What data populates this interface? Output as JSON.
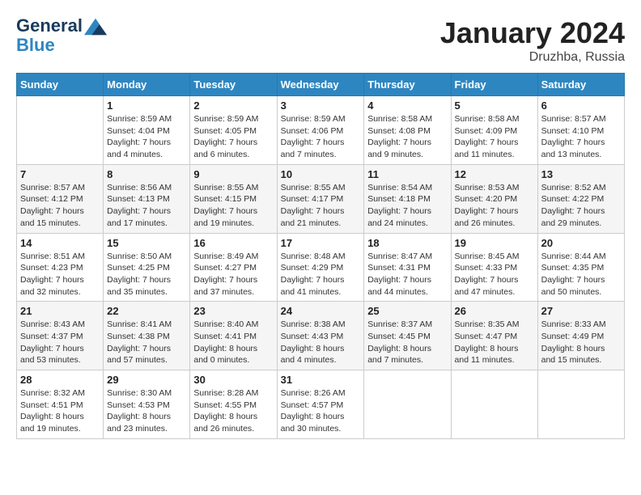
{
  "header": {
    "logo_line1": "General",
    "logo_line2": "Blue",
    "month": "January 2024",
    "location": "Druzhba, Russia"
  },
  "weekdays": [
    "Sunday",
    "Monday",
    "Tuesday",
    "Wednesday",
    "Thursday",
    "Friday",
    "Saturday"
  ],
  "weeks": [
    [
      {
        "day": "",
        "sunrise": "",
        "sunset": "",
        "daylight": ""
      },
      {
        "day": "1",
        "sunrise": "Sunrise: 8:59 AM",
        "sunset": "Sunset: 4:04 PM",
        "daylight": "Daylight: 7 hours and 4 minutes."
      },
      {
        "day": "2",
        "sunrise": "Sunrise: 8:59 AM",
        "sunset": "Sunset: 4:05 PM",
        "daylight": "Daylight: 7 hours and 6 minutes."
      },
      {
        "day": "3",
        "sunrise": "Sunrise: 8:59 AM",
        "sunset": "Sunset: 4:06 PM",
        "daylight": "Daylight: 7 hours and 7 minutes."
      },
      {
        "day": "4",
        "sunrise": "Sunrise: 8:58 AM",
        "sunset": "Sunset: 4:08 PM",
        "daylight": "Daylight: 7 hours and 9 minutes."
      },
      {
        "day": "5",
        "sunrise": "Sunrise: 8:58 AM",
        "sunset": "Sunset: 4:09 PM",
        "daylight": "Daylight: 7 hours and 11 minutes."
      },
      {
        "day": "6",
        "sunrise": "Sunrise: 8:57 AM",
        "sunset": "Sunset: 4:10 PM",
        "daylight": "Daylight: 7 hours and 13 minutes."
      }
    ],
    [
      {
        "day": "7",
        "sunrise": "Sunrise: 8:57 AM",
        "sunset": "Sunset: 4:12 PM",
        "daylight": "Daylight: 7 hours and 15 minutes."
      },
      {
        "day": "8",
        "sunrise": "Sunrise: 8:56 AM",
        "sunset": "Sunset: 4:13 PM",
        "daylight": "Daylight: 7 hours and 17 minutes."
      },
      {
        "day": "9",
        "sunrise": "Sunrise: 8:55 AM",
        "sunset": "Sunset: 4:15 PM",
        "daylight": "Daylight: 7 hours and 19 minutes."
      },
      {
        "day": "10",
        "sunrise": "Sunrise: 8:55 AM",
        "sunset": "Sunset: 4:17 PM",
        "daylight": "Daylight: 7 hours and 21 minutes."
      },
      {
        "day": "11",
        "sunrise": "Sunrise: 8:54 AM",
        "sunset": "Sunset: 4:18 PM",
        "daylight": "Daylight: 7 hours and 24 minutes."
      },
      {
        "day": "12",
        "sunrise": "Sunrise: 8:53 AM",
        "sunset": "Sunset: 4:20 PM",
        "daylight": "Daylight: 7 hours and 26 minutes."
      },
      {
        "day": "13",
        "sunrise": "Sunrise: 8:52 AM",
        "sunset": "Sunset: 4:22 PM",
        "daylight": "Daylight: 7 hours and 29 minutes."
      }
    ],
    [
      {
        "day": "14",
        "sunrise": "Sunrise: 8:51 AM",
        "sunset": "Sunset: 4:23 PM",
        "daylight": "Daylight: 7 hours and 32 minutes."
      },
      {
        "day": "15",
        "sunrise": "Sunrise: 8:50 AM",
        "sunset": "Sunset: 4:25 PM",
        "daylight": "Daylight: 7 hours and 35 minutes."
      },
      {
        "day": "16",
        "sunrise": "Sunrise: 8:49 AM",
        "sunset": "Sunset: 4:27 PM",
        "daylight": "Daylight: 7 hours and 37 minutes."
      },
      {
        "day": "17",
        "sunrise": "Sunrise: 8:48 AM",
        "sunset": "Sunset: 4:29 PM",
        "daylight": "Daylight: 7 hours and 41 minutes."
      },
      {
        "day": "18",
        "sunrise": "Sunrise: 8:47 AM",
        "sunset": "Sunset: 4:31 PM",
        "daylight": "Daylight: 7 hours and 44 minutes."
      },
      {
        "day": "19",
        "sunrise": "Sunrise: 8:45 AM",
        "sunset": "Sunset: 4:33 PM",
        "daylight": "Daylight: 7 hours and 47 minutes."
      },
      {
        "day": "20",
        "sunrise": "Sunrise: 8:44 AM",
        "sunset": "Sunset: 4:35 PM",
        "daylight": "Daylight: 7 hours and 50 minutes."
      }
    ],
    [
      {
        "day": "21",
        "sunrise": "Sunrise: 8:43 AM",
        "sunset": "Sunset: 4:37 PM",
        "daylight": "Daylight: 7 hours and 53 minutes."
      },
      {
        "day": "22",
        "sunrise": "Sunrise: 8:41 AM",
        "sunset": "Sunset: 4:38 PM",
        "daylight": "Daylight: 7 hours and 57 minutes."
      },
      {
        "day": "23",
        "sunrise": "Sunrise: 8:40 AM",
        "sunset": "Sunset: 4:41 PM",
        "daylight": "Daylight: 8 hours and 0 minutes."
      },
      {
        "day": "24",
        "sunrise": "Sunrise: 8:38 AM",
        "sunset": "Sunset: 4:43 PM",
        "daylight": "Daylight: 8 hours and 4 minutes."
      },
      {
        "day": "25",
        "sunrise": "Sunrise: 8:37 AM",
        "sunset": "Sunset: 4:45 PM",
        "daylight": "Daylight: 8 hours and 7 minutes."
      },
      {
        "day": "26",
        "sunrise": "Sunrise: 8:35 AM",
        "sunset": "Sunset: 4:47 PM",
        "daylight": "Daylight: 8 hours and 11 minutes."
      },
      {
        "day": "27",
        "sunrise": "Sunrise: 8:33 AM",
        "sunset": "Sunset: 4:49 PM",
        "daylight": "Daylight: 8 hours and 15 minutes."
      }
    ],
    [
      {
        "day": "28",
        "sunrise": "Sunrise: 8:32 AM",
        "sunset": "Sunset: 4:51 PM",
        "daylight": "Daylight: 8 hours and 19 minutes."
      },
      {
        "day": "29",
        "sunrise": "Sunrise: 8:30 AM",
        "sunset": "Sunset: 4:53 PM",
        "daylight": "Daylight: 8 hours and 23 minutes."
      },
      {
        "day": "30",
        "sunrise": "Sunrise: 8:28 AM",
        "sunset": "Sunset: 4:55 PM",
        "daylight": "Daylight: 8 hours and 26 minutes."
      },
      {
        "day": "31",
        "sunrise": "Sunrise: 8:26 AM",
        "sunset": "Sunset: 4:57 PM",
        "daylight": "Daylight: 8 hours and 30 minutes."
      },
      {
        "day": "",
        "sunrise": "",
        "sunset": "",
        "daylight": ""
      },
      {
        "day": "",
        "sunrise": "",
        "sunset": "",
        "daylight": ""
      },
      {
        "day": "",
        "sunrise": "",
        "sunset": "",
        "daylight": ""
      }
    ]
  ]
}
